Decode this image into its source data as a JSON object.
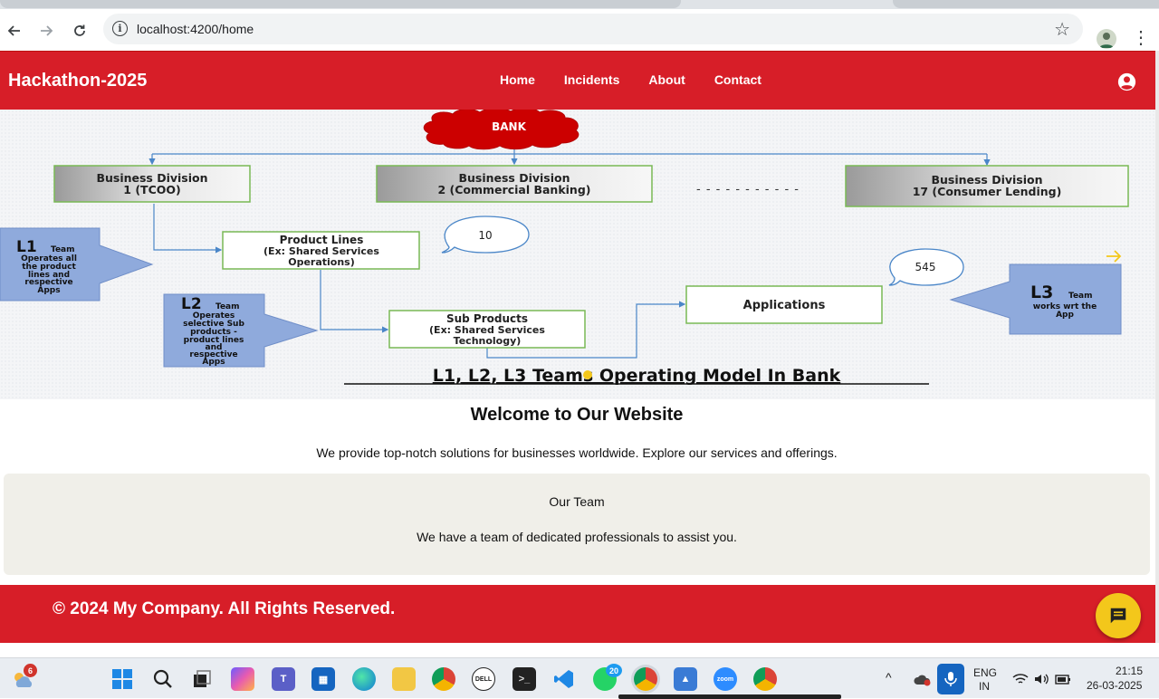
{
  "browser": {
    "url": "localhost:4200/home",
    "icons": [
      "back-icon",
      "forward-icon",
      "reload-icon",
      "site-info-icon",
      "bookmark-star-icon",
      "profile-avatar",
      "menu-kebab-icon"
    ]
  },
  "header": {
    "brand": "Hackathon-2025",
    "nav": [
      "Home",
      "Incidents",
      "About",
      "Contact"
    ],
    "user_icon": "account-circle-icon",
    "color": "#d71e28"
  },
  "diagram": {
    "cloud": "BANK",
    "divisions": [
      {
        "line1": "Business Division",
        "line2": "1 (TCOO)"
      },
      {
        "line1": "Business Division",
        "line2": "2 (Commercial Banking)"
      },
      {
        "line1": "Business Division",
        "line2": "17 (Consumer Lending)"
      }
    ],
    "dashes": "- - - - - - - - - - -",
    "product_lines": {
      "line1": "Product Lines",
      "line2": "(Ex: Shared Services",
      "line3": "Operations)"
    },
    "sub_products": {
      "line1": "Sub Products",
      "line2": "(Ex: Shared Services",
      "line3": "Technology)"
    },
    "applications": "Applications",
    "bubble_10": "10",
    "bubble_545": "545",
    "l1": {
      "big": "L1",
      "small": "Team",
      "desc": [
        "Operates all",
        "the product",
        "lines and",
        "respective",
        "Apps"
      ]
    },
    "l2": {
      "big": "L2",
      "small": "Team",
      "desc": [
        "Operates",
        "selective Sub",
        "products -",
        "product lines",
        "and",
        "respective",
        "Apps"
      ]
    },
    "l3": {
      "big": "L3",
      "small": "Team",
      "desc": [
        "works wrt the",
        "App"
      ]
    },
    "caption": "L1, L2, L3 Teams Operating Model In Bank"
  },
  "welcome": {
    "title": "Welcome to Our Website",
    "subtitle": "We provide top-notch solutions for businesses worldwide. Explore our services and offerings."
  },
  "team": {
    "title": "Our Team",
    "text": "We have a team of dedicated professionals to assist you."
  },
  "footer": {
    "text": "© 2024 My Company. All Rights Reserved."
  },
  "chat_button_icon": "chat-icon",
  "taskbar": {
    "weather_badge": "6",
    "whatsapp_badge": "20",
    "dell_label": "DELL",
    "zoom_label": "zoom",
    "language_line1": "ENG",
    "language_line2": "IN",
    "time": "21:15",
    "date": "26-03-2025"
  }
}
